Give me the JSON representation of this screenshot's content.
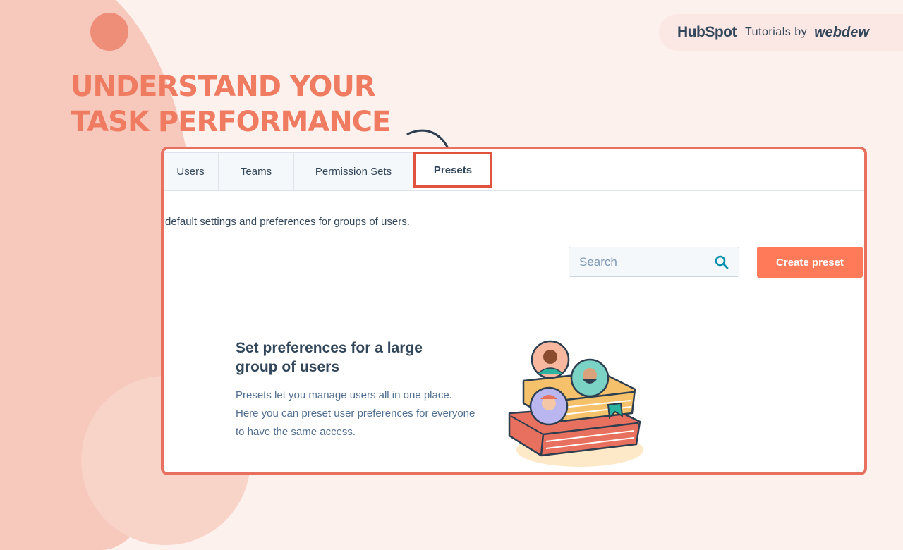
{
  "branding": {
    "hubspot": "HubSpot",
    "tutorials": "Tutorials by",
    "webdew": "webdew"
  },
  "headline": {
    "line1": "UNDERSTAND YOUR",
    "line2": "TASK PERFORMANCE"
  },
  "tabs": [
    {
      "label": "Users"
    },
    {
      "label": "Teams"
    },
    {
      "label": "Permission Sets"
    },
    {
      "label": "Presets",
      "active": true
    }
  ],
  "description": "default settings and preferences for groups of users.",
  "search": {
    "placeholder": "Search",
    "value": ""
  },
  "create_button": "Create preset",
  "empty_state": {
    "title": "Set preferences for a large group of users",
    "text": "Presets let you manage users all in one place. Here you can preset user preferences for everyone to have the same access."
  },
  "icons": [
    "search-icon",
    "curved-arrow-icon",
    "preset-books-illustration"
  ],
  "colors": {
    "accent": "#ff7a59",
    "headline": "#ef7b61",
    "frame": "#e8705f",
    "text": "#33475b"
  }
}
